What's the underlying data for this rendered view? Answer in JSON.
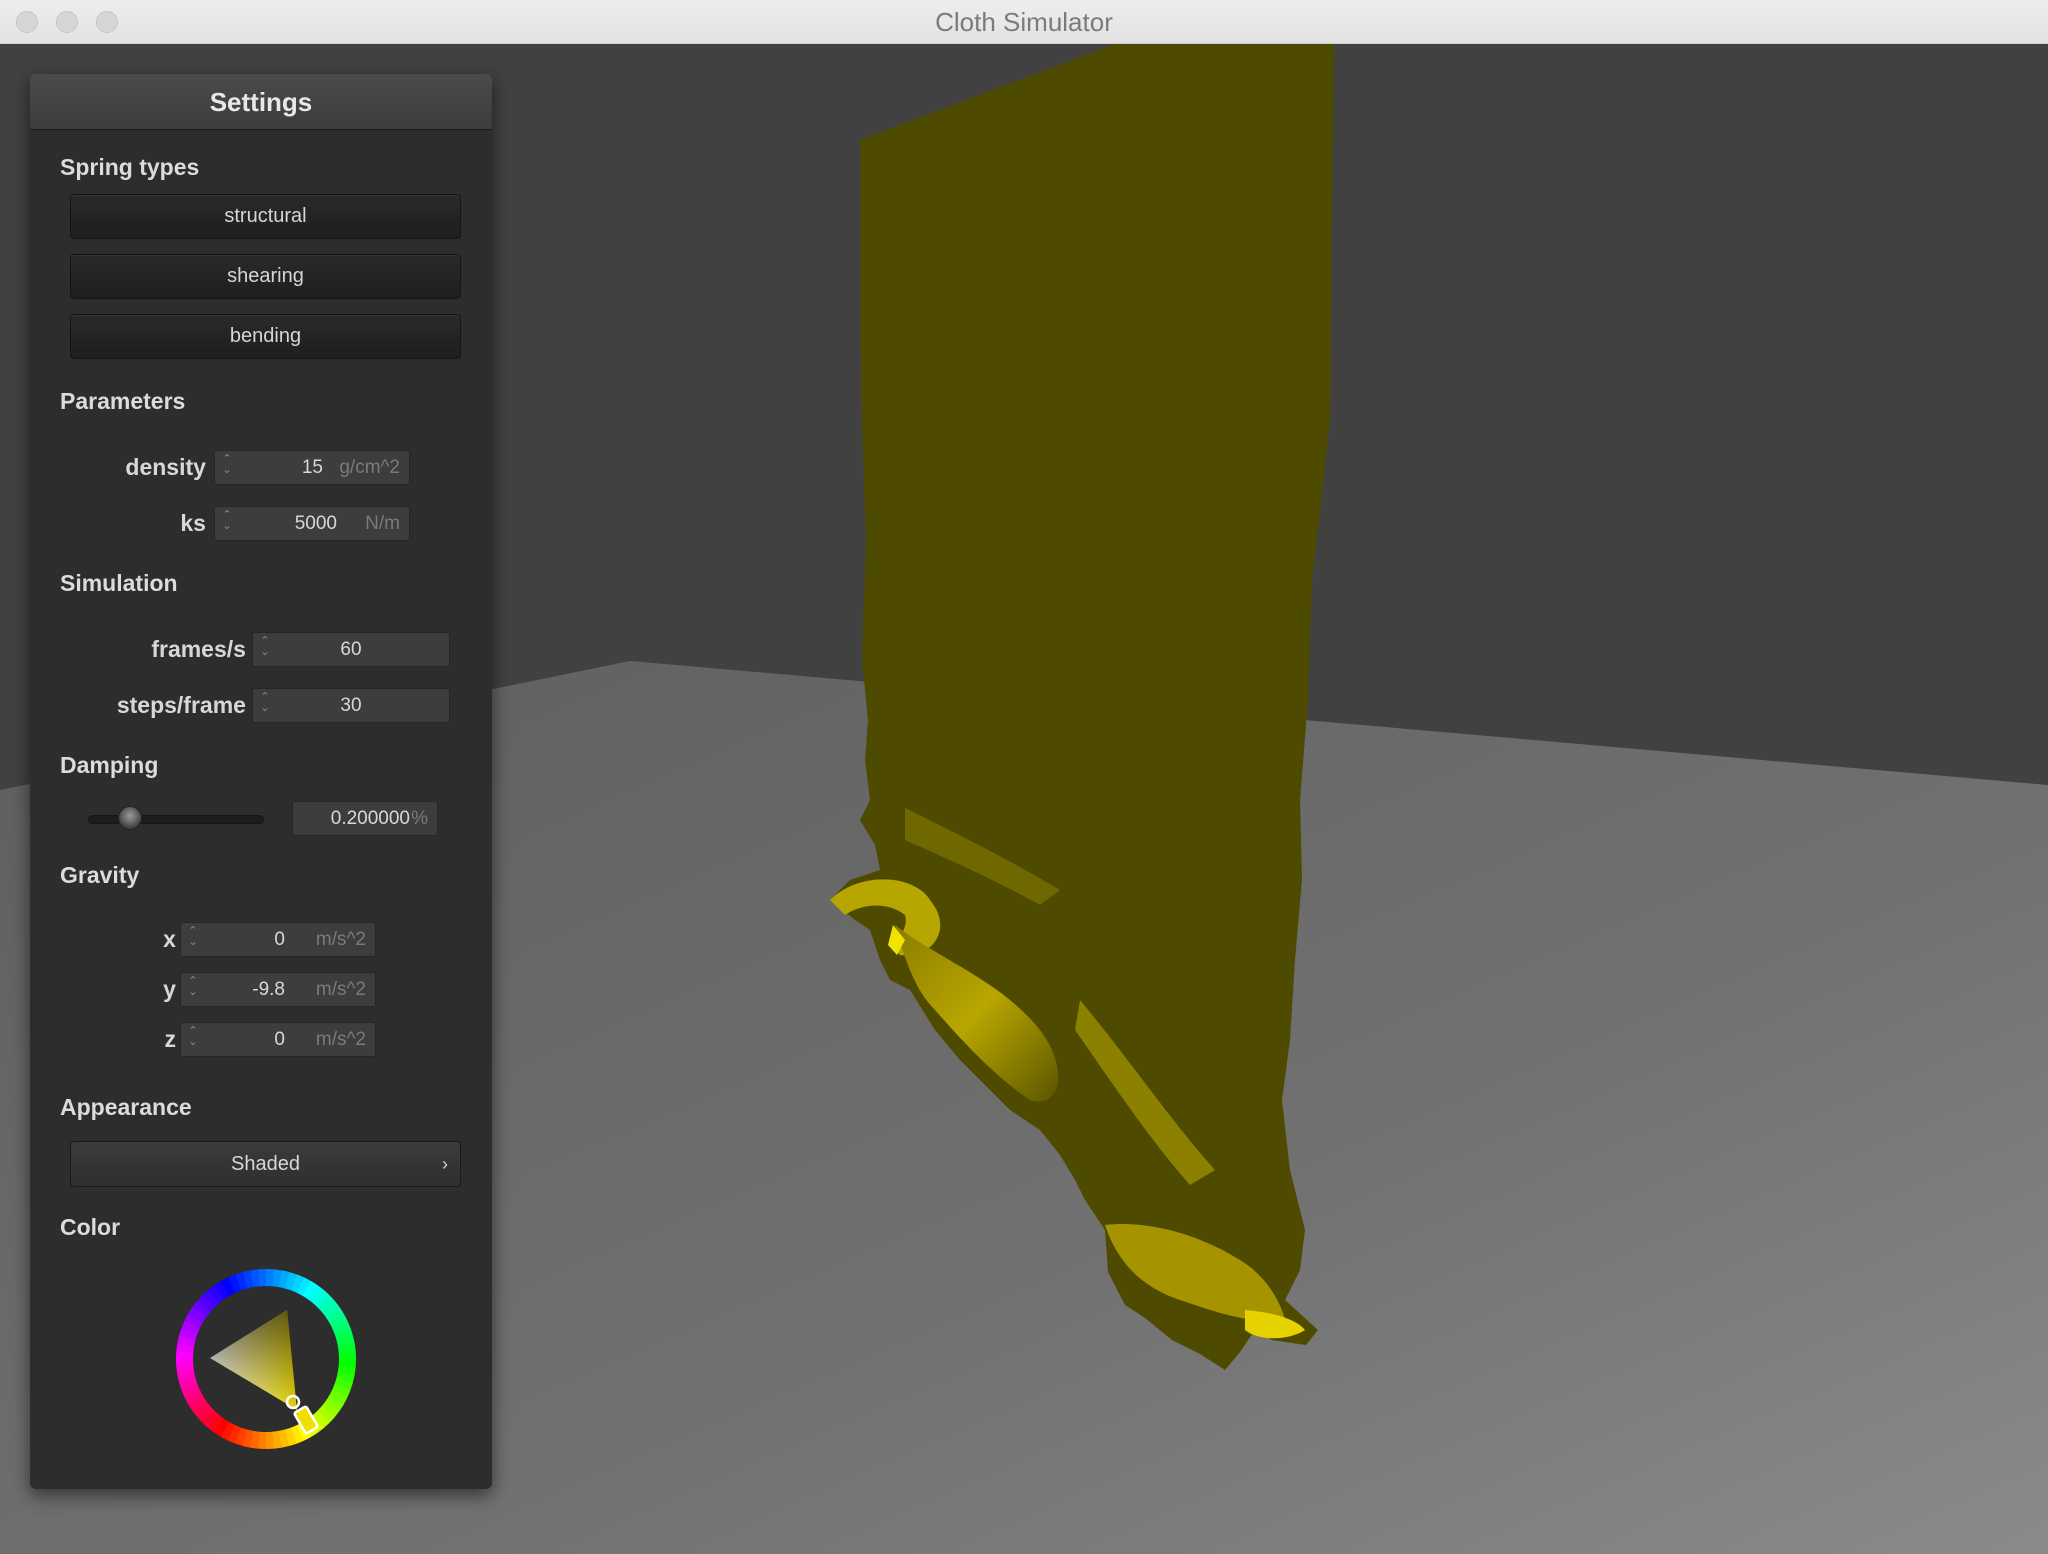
{
  "window": {
    "title": "Cloth Simulator"
  },
  "panel": {
    "title": "Settings",
    "spring_types": {
      "heading": "Spring types",
      "buttons": [
        "structural",
        "shearing",
        "bending"
      ]
    },
    "parameters": {
      "heading": "Parameters",
      "density": {
        "label": "density :",
        "value": "15",
        "unit": "g/cm^2"
      },
      "ks": {
        "label": "ks :",
        "value": "5000",
        "unit": "N/m"
      }
    },
    "simulation": {
      "heading": "Simulation",
      "fps": {
        "label": "frames/s :",
        "value": "60"
      },
      "steps": {
        "label": "steps/frame :",
        "value": "30"
      }
    },
    "damping": {
      "heading": "Damping",
      "value": "0.200000",
      "unit": "%",
      "slider_fraction": 0.2
    },
    "gravity": {
      "heading": "Gravity",
      "x": {
        "label": "x :",
        "value": "0",
        "unit": "m/s^2"
      },
      "y": {
        "label": "y :",
        "value": "-9.8",
        "unit": "m/s^2"
      },
      "z": {
        "label": "z :",
        "value": "0",
        "unit": "m/s^2"
      }
    },
    "appearance": {
      "heading": "Appearance",
      "mode": "Shaded"
    },
    "color": {
      "heading": "Color",
      "selected": "#f0e000"
    }
  },
  "icons": {
    "spinner": "up-down-spinner-icon",
    "dropdown": "chevron-right-icon",
    "color_wheel": "hue-ring-icon"
  },
  "colors": {
    "cloth_dark": "#4e4b00",
    "cloth_bright": "#c8b400",
    "floor": "#6f6f6f",
    "backdrop": "#414141"
  }
}
